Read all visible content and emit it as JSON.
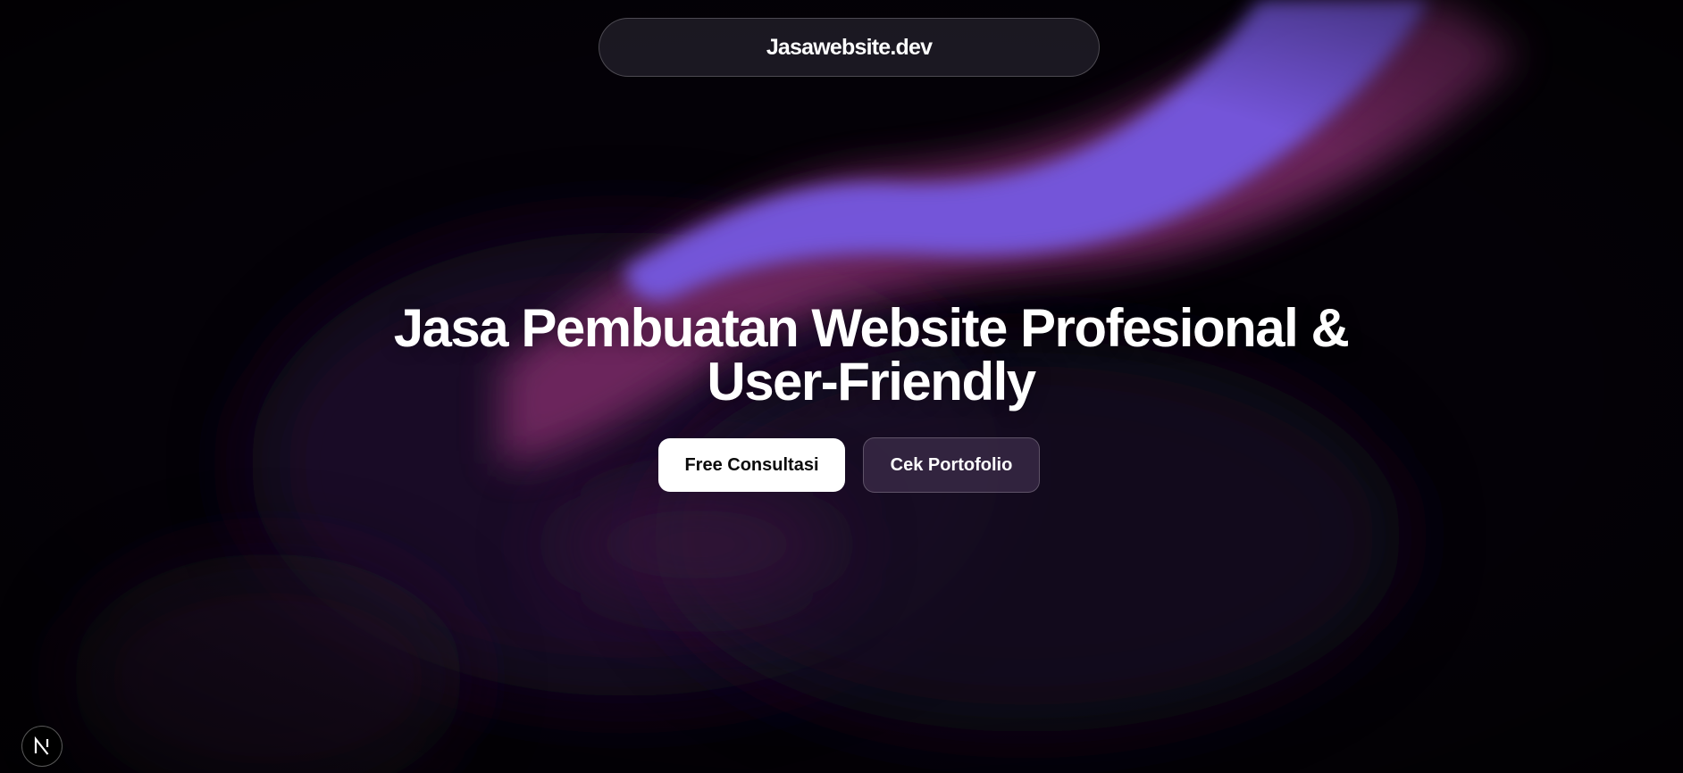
{
  "header": {
    "brand": "Jasawebsite.dev"
  },
  "hero": {
    "title_line1": "Jasa Pembuatan Website Profesional &",
    "title_line2": "User-Friendly",
    "primary_button": "Free Consultasi",
    "secondary_button": "Cek Portofolio"
  },
  "corner_badge": {
    "icon": "nextjs-logo-icon",
    "letter": "N"
  },
  "colors": {
    "background": "#040107",
    "accent_violet": "#7459e0",
    "accent_magenta": "#8a2f6e",
    "button_primary_bg": "#ffffff",
    "button_secondary_bg": "#3c2c4a"
  }
}
